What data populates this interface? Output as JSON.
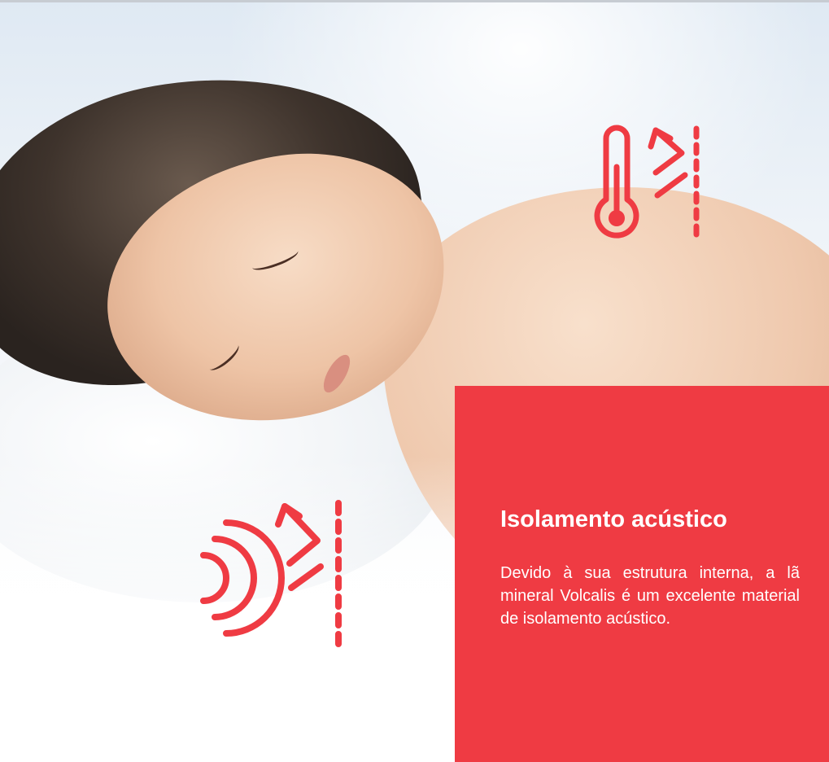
{
  "panel": {
    "title": "Isolamento acústico",
    "body": "Devido à sua estrutura interna, a lã mineral Volcalis é um excelente material de isolamento acústico."
  },
  "icons": {
    "thermal": "thermometer-icon",
    "acoustic": "sound-wave-icon"
  },
  "colors": {
    "accent": "#ef3b43",
    "text_on_accent": "#ffffff"
  }
}
